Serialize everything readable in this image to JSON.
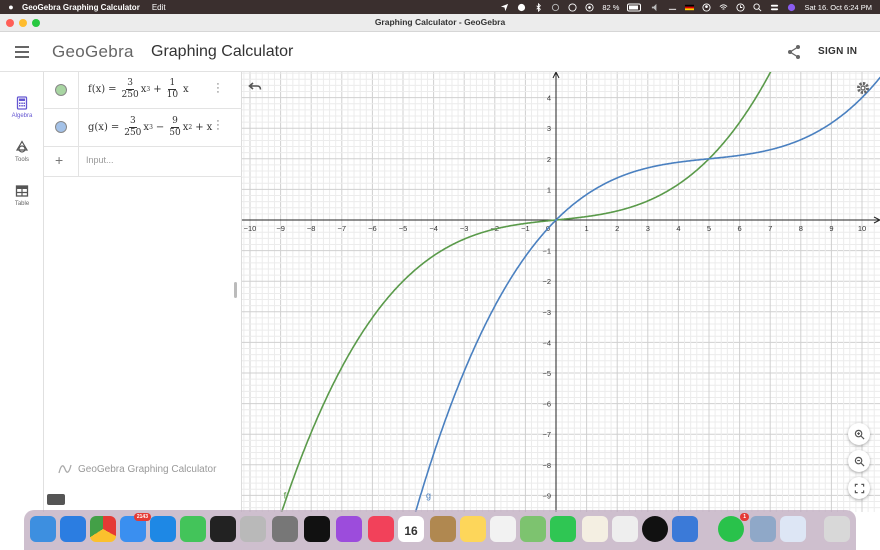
{
  "menubar": {
    "app_name": "GeoGebra Graphing Calculator",
    "menu_edit": "Edit",
    "battery": "82 %",
    "datetime": "Sat 16. Oct  6:24 PM"
  },
  "window": {
    "title": "Graphing Calculator - GeoGebra"
  },
  "header": {
    "logo": "GeoGebra",
    "title": "Graphing Calculator",
    "sign_in": "SIGN IN"
  },
  "rail": {
    "algebra": "Algebra",
    "tools": "Tools",
    "table": "Table"
  },
  "algebra": {
    "f": {
      "name": "f(x)",
      "eq": "=",
      "a_num": "3",
      "a_den": "250",
      "t1": "x",
      "t1_exp": "3",
      "plus": "+",
      "b_num": "1",
      "b_den": "10",
      "t2": "x",
      "color": "#a8d5a2"
    },
    "g": {
      "name": "g(x)",
      "eq": "=",
      "a_num": "3",
      "a_den": "250",
      "t1": "x",
      "t1_exp": "3",
      "minus": "−",
      "b_num": "9",
      "b_den": "50",
      "t2": "x",
      "t2_exp": "2",
      "plus": "+",
      "t3": "x",
      "color": "#a4c2e8"
    },
    "input_placeholder": "Input...",
    "footer": "GeoGebra Graphing Calculator"
  },
  "chart_data": {
    "type": "line",
    "xlim": [
      -10,
      10
    ],
    "ylim": [
      -9,
      4
    ],
    "x_ticks": [
      -10,
      -9,
      -8,
      -7,
      -6,
      -5,
      -4,
      -3,
      -2,
      -1,
      0,
      1,
      2,
      3,
      4,
      5,
      6,
      7,
      8,
      9,
      10
    ],
    "y_ticks": [
      -9,
      -8,
      -7,
      -6,
      -5,
      -4,
      -3,
      -2,
      -1,
      1,
      2,
      3,
      4
    ],
    "grid": true,
    "series": [
      {
        "name": "f",
        "color": "#5a9a4a"
      },
      {
        "name": "g",
        "color": "#4a80c0"
      }
    ]
  },
  "dock": {
    "mail_badge": "2143",
    "calendar_day": "16",
    "whatsapp_badge": "1"
  }
}
